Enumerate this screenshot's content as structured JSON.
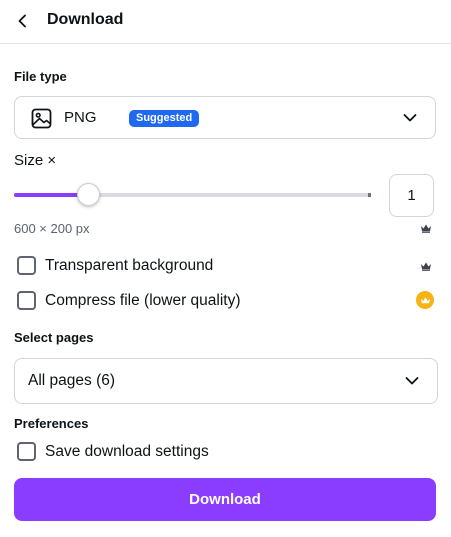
{
  "header": {
    "title": "Download",
    "back_icon": "chevron-left-icon"
  },
  "file_type": {
    "label": "File type",
    "selected": "PNG",
    "badge": "Suggested",
    "icon": "image-icon",
    "badge_color": "#1f68f0"
  },
  "size": {
    "label": "Size ×",
    "value": "1",
    "slider_fraction": 0.21,
    "dimensions": "600 × 200 px",
    "premium_icon": "crown-icon"
  },
  "options": {
    "transparent_label": "Transparent background",
    "compress_label": "Compress file (lower quality)"
  },
  "pages": {
    "label": "Select pages",
    "selected": "All pages (6)"
  },
  "preferences": {
    "label": "Preferences",
    "save_label": "Save download settings"
  },
  "actions": {
    "download_label": "Download"
  },
  "colors": {
    "accent": "#8b3dff",
    "premium": "#f5b316"
  }
}
